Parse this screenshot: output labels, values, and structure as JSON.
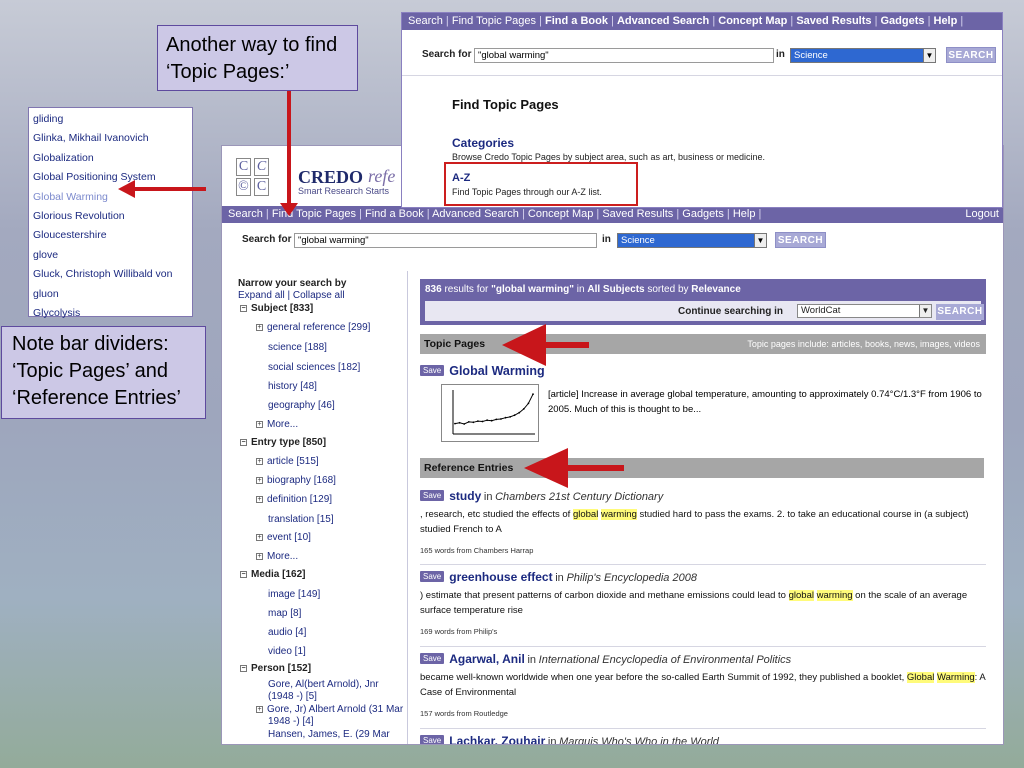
{
  "glossary": {
    "items": [
      {
        "label": "gliding"
      },
      {
        "label": "Glinka, Mikhail Ivanovich"
      },
      {
        "label": "Globalization"
      },
      {
        "label": "Global Positioning System"
      },
      {
        "label": "Global Warming",
        "active": true
      },
      {
        "label": "Glorious Revolution"
      },
      {
        "label": "Gloucestershire"
      },
      {
        "label": "glove"
      },
      {
        "label": "Gluck, Christoph Willibald von"
      },
      {
        "label": "gluon"
      },
      {
        "label": "Glycolysis"
      }
    ]
  },
  "callouts": {
    "topic_line1": "Another way to find",
    "topic_line2": "‘Topic Pages:’",
    "note_line1": "Note bar dividers:",
    "note_line2": "‘Topic Pages’ and",
    "note_line3": "‘Reference Entries’"
  },
  "logo": {
    "brand": "CREDO",
    "brand_suffix": "refe",
    "tagline": "Smart Research Starts"
  },
  "nav": {
    "items": [
      "Search",
      "Find Topic Pages",
      "Find a Book",
      "Advanced Search",
      "Concept Map",
      "Saved Results",
      "Gadgets",
      "Help"
    ],
    "logout": "Logout"
  },
  "search": {
    "label": "Search for",
    "query": "\"global warming\"",
    "in_label": "in",
    "scope": "Science",
    "button": "SEARCH"
  },
  "sidebar": {
    "narrow_title": "Narrow your search by",
    "expand": "Expand all",
    "collapse": "Collapse all",
    "groups": [
      {
        "label": "Subject [833]",
        "items": [
          "general reference [299]",
          "science [188]",
          "social sciences [182]",
          "history [48]",
          "geography [46]",
          "More..."
        ]
      },
      {
        "label": "Entry type [850]",
        "items": [
          "article [515]",
          "biography [168]",
          "definition [129]",
          "translation [15]",
          "event [10]",
          "More..."
        ]
      },
      {
        "label": "Media [162]",
        "items": [
          "image [149]",
          "map [8]",
          "audio [4]",
          "video [1]"
        ]
      },
      {
        "label": "Person [152]",
        "items": [
          "Gore, Al(bert Arnold), Jnr",
          "(1948 -) [5]",
          "Gore, Jr) Albert Arnold (31 Mar",
          "1948 -) [4]",
          "Hansen, James, E. (29 Mar"
        ]
      }
    ]
  },
  "results": {
    "count": "836",
    "results_for": "results for",
    "query": "\"global warming\"",
    "in_word": "in",
    "subjects": "All Subjects",
    "sorted_by": "sorted by",
    "sort": "Relevance",
    "continue_label": "Continue searching in",
    "continue_scope": "WorldCat",
    "continue_button": "SEARCH",
    "save_label": "Save"
  },
  "topic_pages": {
    "bar_label": "Topic Pages",
    "bar_note": "Topic pages include: articles, books, news, images, videos",
    "title": "Global Warming",
    "snippet": "[article] Increase in average global temperature, amounting to approximately 0.74°C/1.3°F from 1906 to 2005. Much of this is thought to be..."
  },
  "reference": {
    "bar_label": "Reference Entries",
    "entries": [
      {
        "title": "study",
        "in": "in",
        "source": "Chambers 21st Century Dictionary",
        "pre": ", research, etc studied the effects of ",
        "hl1": "global",
        "mid": " ",
        "hl2": "warming",
        "post": " studied hard to pass the exams. 2. to take an educational course in (a subject) studied French to A",
        "meta": "165 words from Chambers Harrap"
      },
      {
        "title": "greenhouse effect",
        "in": "in",
        "source": "Philip's Encyclopedia 2008",
        "pre": ") estimate that present patterns of carbon dioxide and methane emissions could lead to ",
        "hl1": "global",
        "mid": " ",
        "hl2": "warming",
        "post": " on the scale of an average surface temperature rise",
        "meta": "169 words from Philip's"
      },
      {
        "title": "Agarwal, Anil",
        "in": "in",
        "source": "International Encyclopedia of Environmental Politics",
        "pre": "became well-known worldwide when one year before the so-called Earth Summit of 1992, they published a booklet, ",
        "hl1": "Global",
        "mid": " ",
        "hl2": "Warming",
        "post": ": A Case of Environmental",
        "meta": "157 words from Routledge"
      },
      {
        "title": "Lachkar, Zouhair",
        "in": "in",
        "source": "Marquis Who's Who in the World"
      }
    ]
  },
  "popup": {
    "nav_items": [
      "Search",
      "Find Topic Pages",
      "Find a Book",
      "Advanced Search",
      "Concept Map",
      "Saved Results",
      "Gadgets",
      "Help"
    ],
    "heading": "Find Topic Pages",
    "categories_title": "Categories",
    "categories_desc": "Browse Credo Topic Pages by subject area, such as art, business or medicine.",
    "az_title": "A-Z",
    "az_desc": "Find Topic Pages through our A-Z list."
  },
  "chart_data": {
    "type": "line",
    "x": [
      1,
      2,
      3,
      4,
      5,
      6,
      7,
      8,
      9,
      10,
      11,
      12,
      13,
      14,
      15,
      16,
      17,
      18
    ],
    "values": [
      0.2,
      0.22,
      0.19,
      0.24,
      0.23,
      0.26,
      0.25,
      0.28,
      0.27,
      0.3,
      0.31,
      0.34,
      0.36,
      0.4,
      0.46,
      0.55,
      0.68,
      0.9
    ],
    "ylim": [
      0,
      1
    ]
  },
  "colors": {
    "accent": "#6c64a6",
    "arrow": "#c8161b",
    "link": "#1c2a80",
    "highlight": "#fffb7a"
  }
}
